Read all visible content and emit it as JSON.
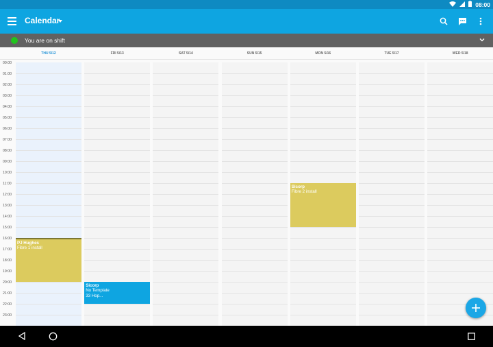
{
  "status_bar": {
    "time": "08:00",
    "icons": [
      "wifi-icon",
      "signal-icon",
      "battery-icon"
    ]
  },
  "app_bar": {
    "title": "Calendar",
    "actions": [
      "search-icon",
      "chat-icon",
      "more-vert-icon"
    ],
    "background_color": "#0ea5e1"
  },
  "shift_bar": {
    "text": "You are on shift",
    "status_color": "#20c41d"
  },
  "days": [
    {
      "label": "THU 5/12",
      "today": true
    },
    {
      "label": "FRI 5/13",
      "today": false
    },
    {
      "label": "SAT 5/14",
      "today": false
    },
    {
      "label": "SUN 5/15",
      "today": false
    },
    {
      "label": "MON 5/16",
      "today": false
    },
    {
      "label": "TUE 5/17",
      "today": false
    },
    {
      "label": "WED 5/18",
      "today": false
    }
  ],
  "hours": [
    "00:00",
    "01:00",
    "02:00",
    "03:00",
    "04:00",
    "05:00",
    "06:00",
    "07:00",
    "08:00",
    "09:00",
    "10:00",
    "11:00",
    "12:00",
    "13:00",
    "14:00",
    "15:00",
    "16:00",
    "17:00",
    "18:00",
    "19:00",
    "20:00",
    "21:00",
    "22:00",
    "23:00"
  ],
  "events": [
    {
      "title": "PJ Hughes",
      "subtitle": "Fibre 1 install",
      "detail": "",
      "day": 0,
      "start": 16,
      "end": 20,
      "color": "#dccb5e"
    },
    {
      "title": "Sicorp",
      "subtitle": "No Template",
      "detail": "33 Hop...",
      "day": 1,
      "start": 20,
      "end": 22,
      "color": "#0ea5e1"
    },
    {
      "title": "Sicorp",
      "subtitle": "Fibre 2 install",
      "detail": "",
      "day": 4,
      "start": 11,
      "end": 15,
      "color": "#dccb5e"
    }
  ],
  "fab": {
    "icon": "plus-icon"
  },
  "nav_bar": {
    "icons": [
      "back-icon",
      "home-icon",
      "recents-icon"
    ]
  }
}
